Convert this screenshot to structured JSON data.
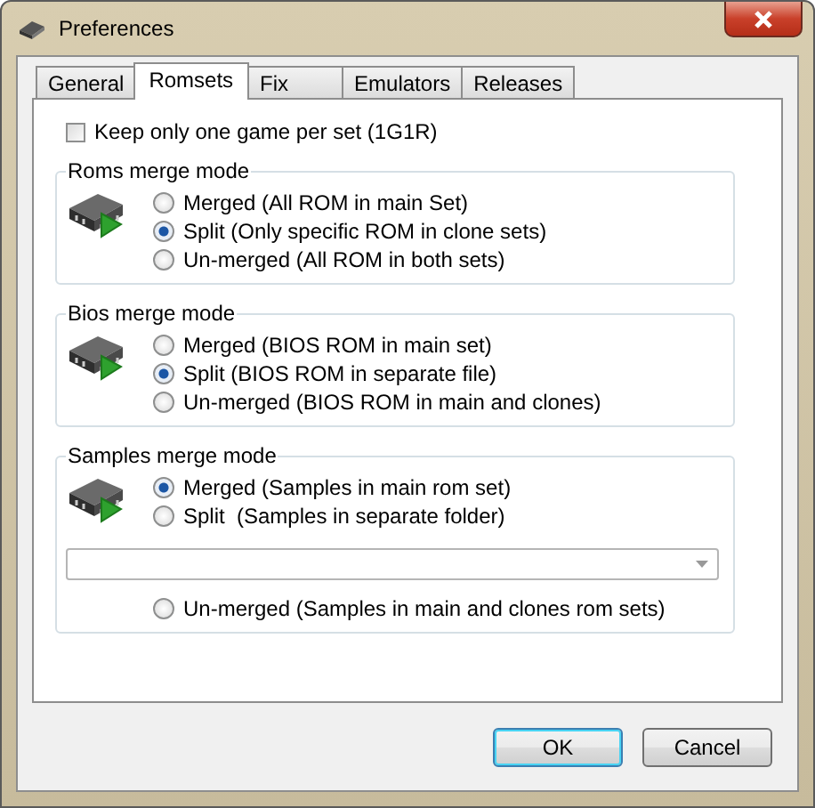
{
  "window": {
    "title": "Preferences"
  },
  "tabs": [
    {
      "label": "General",
      "selected": false
    },
    {
      "label": "Romsets",
      "selected": true
    },
    {
      "label": "Fix",
      "selected": false
    },
    {
      "label": "Emulators",
      "selected": false
    },
    {
      "label": "Releases",
      "selected": false
    }
  ],
  "checkbox": {
    "label": "Keep only one game per set (1G1R)",
    "checked": false
  },
  "groups": [
    {
      "title": "Roms merge mode",
      "items": [
        {
          "kind": "radio",
          "label": "Merged (All ROM in main Set)",
          "selected": false
        },
        {
          "kind": "radio",
          "label": "Split (Only specific ROM in clone sets)",
          "selected": true
        },
        {
          "kind": "radio",
          "label": "Un-merged (All ROM in both sets)",
          "selected": false
        }
      ]
    },
    {
      "title": "Bios merge mode",
      "items": [
        {
          "kind": "radio",
          "label": "Merged (BIOS ROM in main set)",
          "selected": false
        },
        {
          "kind": "radio",
          "label": "Split (BIOS ROM in separate file)",
          "selected": true
        },
        {
          "kind": "radio",
          "label": "Un-merged (BIOS ROM in main and clones)",
          "selected": false
        }
      ]
    },
    {
      "title": "Samples merge mode",
      "items": [
        {
          "kind": "radio",
          "label": "Merged (Samples in main rom set)",
          "selected": true
        },
        {
          "kind": "radio",
          "label": "Split  (Samples in separate folder)",
          "selected": false
        },
        {
          "kind": "dropdown"
        },
        {
          "kind": "radio",
          "label": "Un-merged (Samples in main and clones rom sets)",
          "selected": false
        }
      ]
    }
  ],
  "buttons": [
    "OK",
    "Cancel"
  ]
}
